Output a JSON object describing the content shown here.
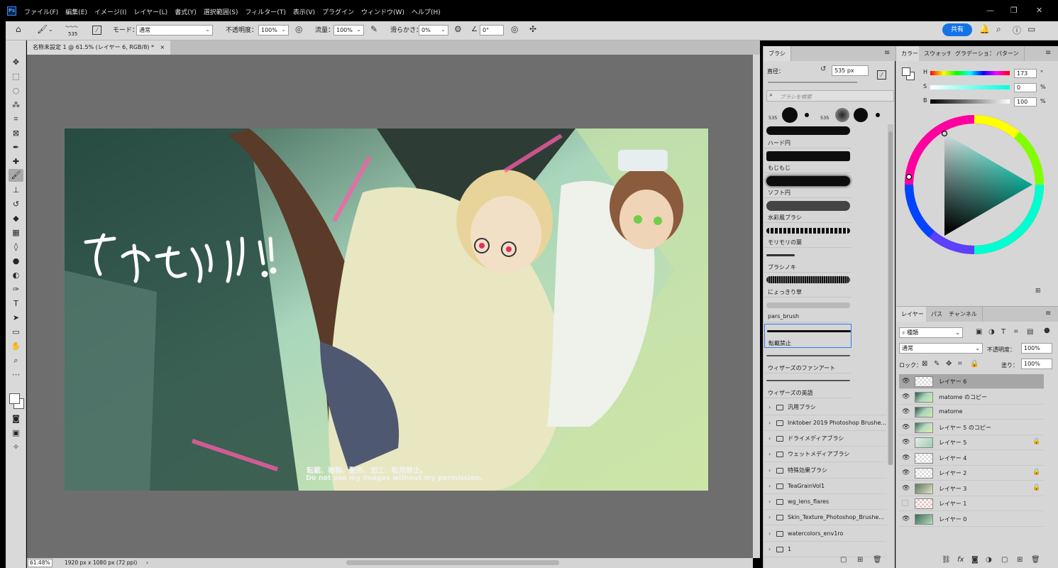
{
  "app": {
    "logo": "Ps"
  },
  "menu": [
    "ファイル(F)",
    "編集(E)",
    "イメージ(I)",
    "レイヤー(L)",
    "書式(Y)",
    "選択範囲(S)",
    "フィルター(T)",
    "表示(V)",
    "プラグイン",
    "ウィンドウ(W)",
    "ヘルプ(H)"
  ],
  "options": {
    "brush_size": "535",
    "mode_label": "モード：",
    "mode_value": "通常",
    "opacity_label": "不透明度：",
    "opacity_value": "100%",
    "flow_label": "流量：",
    "flow_value": "100%",
    "smoothing_label": "滑らかさ：",
    "smoothing_value": "0%",
    "angle_value": "0°",
    "share_label": "共有"
  },
  "document": {
    "tab_title": "名称未設定 1 @ 61.5% (レイヤー 6, RGB/8) *",
    "zoom": "61.48%",
    "info": "1920 px x 1080 px (72 ppi)",
    "artwork_text_ja": "転載、複製、配布、加工、転用禁止。",
    "artwork_text_en": "Do not use my images without my permission."
  },
  "brush_panel": {
    "tab": "ブラシ",
    "size_label": "直径：",
    "size_value": "535 px",
    "search_placeholder": "ブラシを検索",
    "preset_size_1": "535",
    "preset_size_2": "535",
    "brushes": [
      "ハード円",
      "もじもじ",
      "ソフト円",
      "水彩風ブラシ",
      "モリモリの葉",
      "ブラシノキ",
      "にょっきり草",
      "pars_brush",
      "転載禁止",
      "ウィザーズのファンアート",
      "ウィザーズの英語"
    ],
    "folders": [
      "汎用ブラシ",
      "Inktober 2019 Photoshop Brushe...",
      "ドライメディアブラシ",
      "ウェットメディアブラシ",
      "特殊効果ブラシ",
      "TeaGrainVol1",
      "wg_lens_flares",
      "Skin_Texture_Photoshop_Brushe...",
      "watercolors_env1ro",
      "1"
    ]
  },
  "color_panel": {
    "tabs": [
      "カラー",
      "スウォッチ",
      "グラデーション",
      "パターン"
    ],
    "h_label": "H",
    "h_value": "173",
    "h_unit": "°",
    "s_label": "S",
    "s_value": "0",
    "s_unit": "%",
    "b_label": "B",
    "b_value": "100",
    "b_unit": "%"
  },
  "layers_panel": {
    "tabs": [
      "レイヤー",
      "パス",
      "チャンネル"
    ],
    "filter_label": "種類",
    "blend_mode": "通常",
    "opacity_label": "不透明度：",
    "opacity_value": "100%",
    "lock_label": "ロック：",
    "fill_label": "塗り：",
    "fill_value": "100%",
    "layers": [
      "レイヤー 6",
      "matome のコピー",
      "matome",
      "レイヤー 5 のコピー",
      "レイヤー 5",
      "レイヤー 4",
      "レイヤー 2",
      "レイヤー 3",
      "レイヤー 1",
      "レイヤー 0"
    ]
  },
  "colors": {
    "accent": "#1473e6",
    "panel_bg": "#d6d6d6",
    "canvas_bg": "#6e6e6e"
  }
}
